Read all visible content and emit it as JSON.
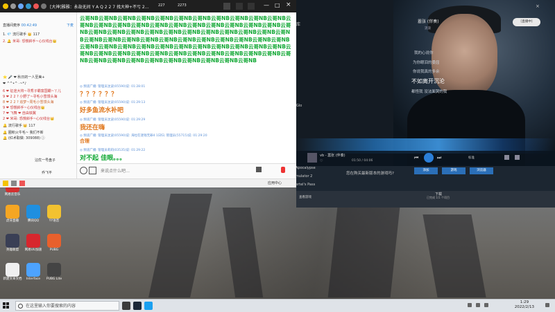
{
  "chat_window": {
    "title": "[大神]雅雅：永劫无间 Y A Q 2 2 7 找大神+不亏 2…",
    "counts": [
      "227",
      "2273"
    ],
    "panel_header": {
      "label": "直播间麦序",
      "counter": "00:42:49",
      "tag": "下麦"
    },
    "users": [
      {
        "name": "1. 💎 流行歌手 👑 117"
      },
      {
        "name": "2. 🔔 米哥: 恐慌斜手~心仪线台👑"
      }
    ],
    "user_list": [
      "⭐ 🎤 ❤ 秋日的一人至美+",
      "❤ ^^•^ ·~*♪",
      "6 ❤ 征途大将~寻秀子霸富国霸~丫儿",
      "9 ❤ 2 2 ? 小野了~寻毛小雪馒头海",
      "8 ❤ 2 2 ? 追梦~周毛小雪馒头海",
      "9 ❤ 恐慌斜手~心仪线台👑",
      "7 ❤ 飞舞 ❤ 自由铁翼",
      "2 ❤ 米哥: 恐慌斜手~心仪线台👑",
      "🔔 流行歌手 👑 117",
      "🔔 圈积火牛毛~ 我们不新",
      "🔔 (红术取做: 309088) ⓘ",
      "沾优一号盘子",
      "乔飞平"
    ],
    "nb_wall": "云哥NB云哥NB云哥NB云哥NB云哥NB云哥NB云哥NB云哥NB云哥NB云哥NB云哥NB云哥NB云哥NB云哥NB云哥NB云哥NB云哥NB云哥NB云哥NB云哥NB云哥NB云哥NB云哥NB云哥NB云哥NB云哥NB云哥NB云哥NB云哥NB云哥NB云哥NB云哥NB云哥NB云哥NB云哥NB云哥NB云哥NB云哥NB云哥NB云哥NB云哥NB云哥NB云哥NB云哥NB云哥NB云哥NB云哥NB云哥NB云哥NB云哥NB云哥NB云哥NB云哥NB云哥NB云哥NB云哥NB云哥NB云哥NB云哥NB云哥NB云哥NB云哥NB云哥NB云哥NB云哥NB云哥NB云哥NB云哥NB云哥NB云哥NB云哥NB云哥NB云哥NB云哥NB云哥NB云哥NB云哥NB",
    "messages": [
      {
        "meta": "◎ 频道广播: 管理员沈波(05590)说: 01:28:01",
        "text": "？？？？？？",
        "color": "#e0781f"
      },
      {
        "meta": "◎ 频道广播: 管理员沈波(05590)说: 01:29:13",
        "text": "好多鱼流水补吧",
        "color": "#e0781f"
      },
      {
        "meta": "◎ 频道广播: 管理员沈波(05590)说: 01:29:29",
        "text": "我还在嗨",
        "color": "#e0781f"
      },
      {
        "meta": "◎ 频道广播: 管理员沈波(05590)说: 海拉在逐钱无罪4 1日归. 管理员(55715)说: 01:29:20",
        "text": "合理",
        "color": "#e0781f"
      },
      {
        "meta": "◎ 频道广播: 管理员莉莉(03535)说: 01:29:22",
        "text": "对不起 佳眼。。。",
        "color": "#12a835"
      }
    ],
    "input_placeholder": "来说点什么吧…",
    "status_items": [
      "应用中心"
    ]
  },
  "music_window": {
    "song_title": "嚣张 (伴奏)",
    "artist": "流浪",
    "badge": "[直播中]",
    "lyrics": [
      "我的心说你",
      "为你眼泪的委屈",
      "你说我真的多余",
      "不如离开沉沦",
      "都怪我 没法面哭的我"
    ],
    "current_lyric": "不如离开沉沦",
    "now_playing": "vb - 嚣张 (伴奏)",
    "time": "01:50 / 04:06",
    "quality": "标准",
    "left_items": [
      "Apocalypse",
      "mulator 2",
      "ertel's Pass"
    ],
    "left_sidebar": [
      "库",
      "Glo"
    ],
    "panel_text": "您在购买最新版本的游戏吗?",
    "panel_link": "查看游戏",
    "download_label": "下载",
    "download_sub": "已完成 1/1 个项目",
    "buttons": [
      "添加",
      "游戏",
      "浏览器"
    ]
  },
  "desktop_icons": [
    {
      "label": "网易云音乐",
      "color": "#d33030"
    },
    {
      "label": "虎牙直播",
      "color": "#f5a623"
    },
    {
      "label": "腾讯QQ",
      "color": "#1f8fe0"
    },
    {
      "label": "YY语音",
      "color": "#f2c230"
    },
    {
      "label": "英雄联盟",
      "color": "#3a3f55"
    },
    {
      "label": "网易UU加速",
      "color": "#d7262d"
    },
    {
      "label": "PUBG",
      "color": "#e8602c"
    },
    {
      "label": "新建文本文档",
      "color": "#f0f0f0"
    },
    {
      "label": "Interface",
      "color": "#4da3ff"
    },
    {
      "label": "PUBG Lite",
      "color": "#444"
    }
  ],
  "taskbar": {
    "search_placeholder": "在这里输入你要搜索的内容",
    "time": "1:29",
    "date": "2022/2/13"
  },
  "colors": {
    "nb_green": "#12a835",
    "accent_blue": "#2b6fb8",
    "title_bar": "#1f1f1f"
  }
}
